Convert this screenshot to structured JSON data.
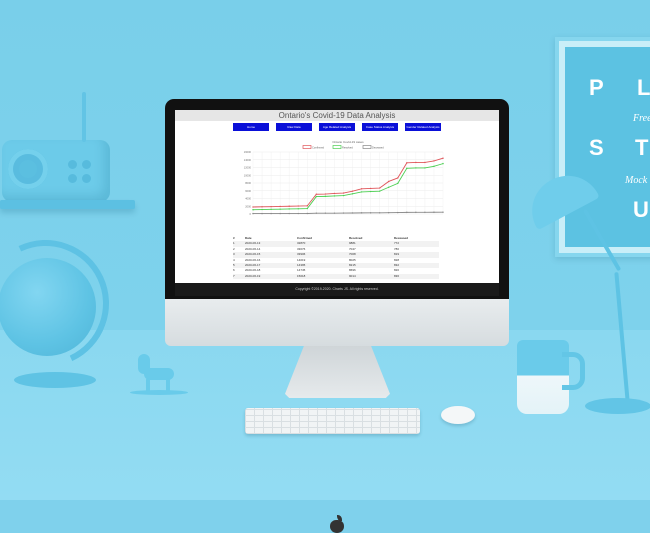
{
  "page": {
    "title": "Ontario's Covid-19 Data Analysis",
    "nav": [
      "Home",
      "Raw Data",
      "Age Related Analysis",
      "Case Status Analysis",
      "Gender Related Analysis"
    ],
    "footer": "Copyright ©2019-2020. Charts JS. All rights reserved."
  },
  "chart_data": {
    "type": "line",
    "title": "Ontario Covid-19 cases",
    "series": [
      {
        "name": "Confirmed",
        "color": "#e0555a",
        "values": [
          1800,
          1850,
          1900,
          1950,
          2000,
          2050,
          2100,
          5100,
          5150,
          5300,
          5400,
          5900,
          6500,
          6600,
          6700,
          8400,
          9300,
          13200,
          13300,
          13300,
          13700,
          14400
        ]
      },
      {
        "name": "Resolved",
        "color": "#4ccf52",
        "values": [
          1100,
          1150,
          1200,
          1250,
          1300,
          1350,
          1400,
          4500,
          4550,
          4650,
          4750,
          5200,
          5700,
          5800,
          5900,
          6900,
          7900,
          11800,
          11900,
          11900,
          12300,
          13000
        ]
      },
      {
        "name": "Deceased",
        "color": "#888888",
        "values": [
          100,
          100,
          110,
          110,
          120,
          120,
          130,
          200,
          210,
          220,
          230,
          260,
          290,
          300,
          310,
          340,
          370,
          420,
          430,
          440,
          450,
          460
        ]
      }
    ],
    "ylim": [
      0,
      16000
    ],
    "y_ticks": [
      "16000",
      "14000",
      "12000",
      "10000",
      "8000",
      "6000",
      "4000",
      "2000",
      "0"
    ],
    "grid": true,
    "legend": "top"
  },
  "table": {
    "headers": [
      "#",
      "Date",
      "Confirmed",
      "Resolved",
      "Deceased"
    ],
    "rows": [
      [
        "1",
        "2020-06-13",
        "32870",
        "9881",
        "772"
      ],
      [
        "2",
        "2020-06-14",
        "33076",
        "7047",
        "780"
      ],
      [
        "3",
        "2020-06-15",
        "33906",
        "7008",
        "819"
      ],
      [
        "4",
        "2020-06-16",
        "14019",
        "8025",
        "828"
      ],
      [
        "5",
        "2020-06-17",
        "14395",
        "8215",
        "832"
      ],
      [
        "6",
        "2020-06-18",
        "14745",
        "8696",
        "820"
      ],
      [
        "7",
        "2020-06-19",
        "15018",
        "9014",
        "836"
      ]
    ]
  },
  "colors": {
    "nav_button": "#0a0fd8",
    "footer": "#1a1a1a",
    "background": "#7fd1ec"
  }
}
